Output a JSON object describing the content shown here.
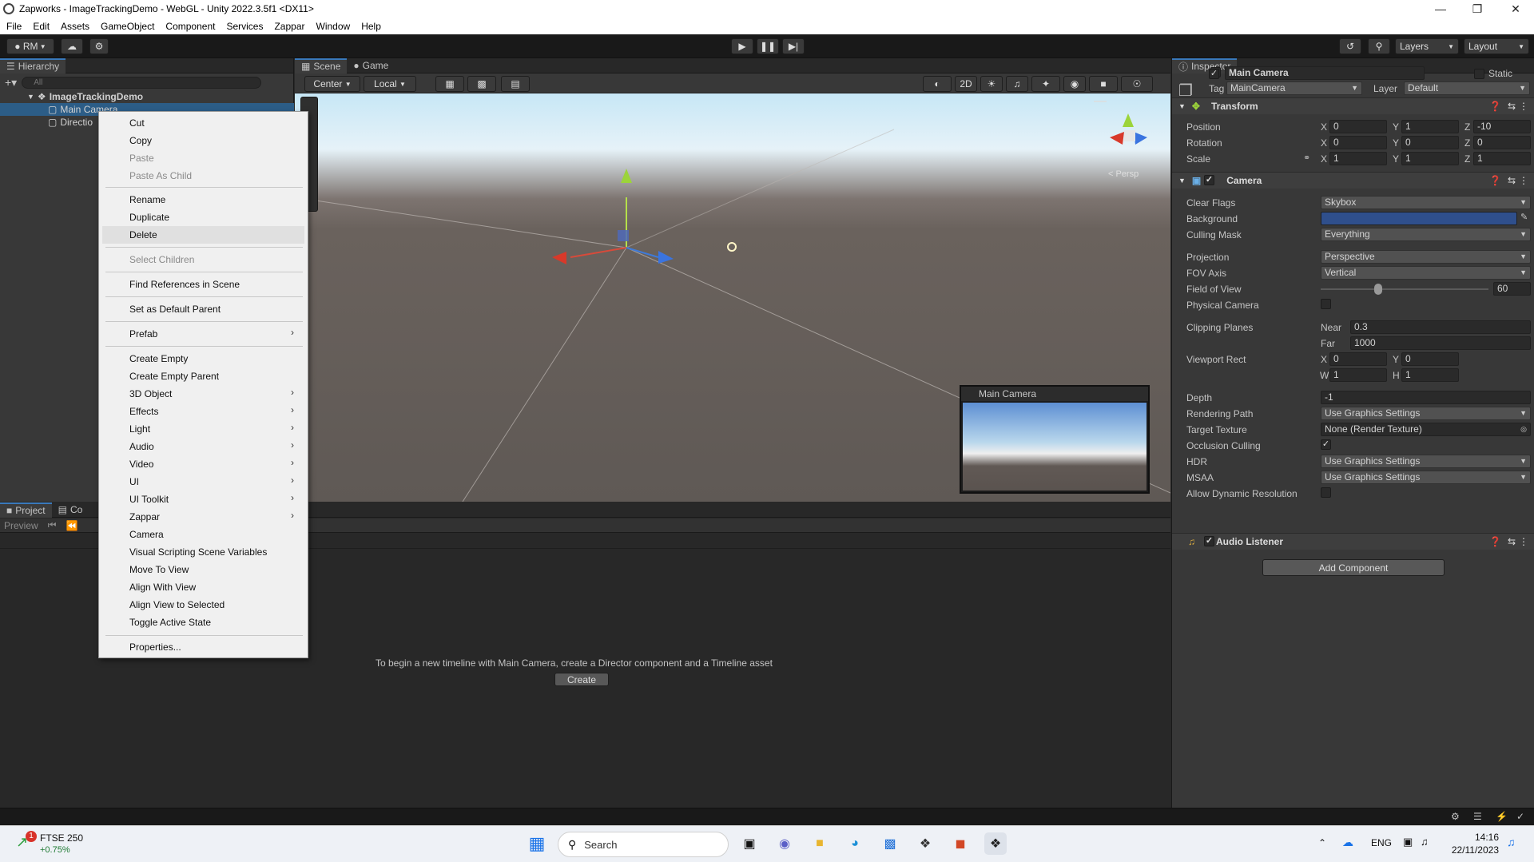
{
  "window": {
    "title": "Zapworks - ImageTrackingDemo - WebGL - Unity 2022.3.5f1 <DX11>"
  },
  "menu": [
    "File",
    "Edit",
    "Assets",
    "GameObject",
    "Component",
    "Services",
    "Zappar",
    "Window",
    "Help"
  ],
  "toolbar": {
    "account": "RM",
    "layers": "Layers",
    "layout": "Layout"
  },
  "hierarchy": {
    "tab": "Hierarchy",
    "search_placeholder": "All",
    "scene_name": "ImageTrackingDemo",
    "items": [
      "Main Camera",
      "Directio"
    ]
  },
  "scene": {
    "tabs": [
      "Scene",
      "Game"
    ],
    "pivot": "Center",
    "space": "Local",
    "mode_2d": "2D",
    "persp": "< Persp",
    "preview_title": "Main Camera"
  },
  "context_menu": [
    {
      "label": "Cut",
      "disabled": false
    },
    {
      "label": "Copy",
      "disabled": false
    },
    {
      "label": "Paste",
      "disabled": true
    },
    {
      "label": "Paste As Child",
      "disabled": true
    },
    {
      "label": "Rename",
      "disabled": false
    },
    {
      "label": "Duplicate",
      "disabled": false
    },
    {
      "label": "Delete",
      "disabled": false
    },
    {
      "label": "Select Children",
      "disabled": true
    },
    {
      "label": "Find References in Scene",
      "disabled": false
    },
    {
      "label": "Set as Default Parent",
      "disabled": false
    },
    {
      "label": "Prefab",
      "disabled": false,
      "submenu": true
    },
    {
      "label": "Create Empty",
      "disabled": false
    },
    {
      "label": "Create Empty Parent",
      "disabled": false
    },
    {
      "label": "3D Object",
      "disabled": false,
      "submenu": true
    },
    {
      "label": "Effects",
      "disabled": false,
      "submenu": true
    },
    {
      "label": "Light",
      "disabled": false,
      "submenu": true
    },
    {
      "label": "Audio",
      "disabled": false,
      "submenu": true
    },
    {
      "label": "Video",
      "disabled": false,
      "submenu": true
    },
    {
      "label": "UI",
      "disabled": false,
      "submenu": true
    },
    {
      "label": "UI Toolkit",
      "disabled": false,
      "submenu": true
    },
    {
      "label": "Zappar",
      "disabled": false,
      "submenu": true
    },
    {
      "label": "Camera",
      "disabled": false
    },
    {
      "label": "Visual Scripting Scene Variables",
      "disabled": false
    },
    {
      "label": "Move To View",
      "disabled": false
    },
    {
      "label": "Align With View",
      "disabled": false
    },
    {
      "label": "Align View to Selected",
      "disabled": false
    },
    {
      "label": "Toggle Active State",
      "disabled": false
    },
    {
      "label": "Properties...",
      "disabled": false
    }
  ],
  "project": {
    "tabs": [
      "Project",
      "Co"
    ],
    "preview": "Preview",
    "timeline_msg": "To begin a new timeline with Main Camera, create a Director component and a Timeline asset",
    "create_button": "Create"
  },
  "inspector": {
    "tab": "Inspector",
    "object_name": "Main Camera",
    "static_label": "Static",
    "tag_label": "Tag",
    "tag_value": "MainCamera",
    "layer_label": "Layer",
    "layer_value": "Default",
    "transform": {
      "title": "Transform",
      "position_label": "Position",
      "position": [
        "0",
        "1",
        "-10"
      ],
      "rotation_label": "Rotation",
      "rotation": [
        "0",
        "0",
        "0"
      ],
      "scale_label": "Scale",
      "scale": [
        "1",
        "1",
        "1"
      ]
    },
    "camera": {
      "title": "Camera",
      "clear_flags_label": "Clear Flags",
      "clear_flags": "Skybox",
      "background_label": "Background",
      "background_color": "#2f4f8c",
      "culling_mask_label": "Culling Mask",
      "culling_mask": "Everything",
      "projection_label": "Projection",
      "projection": "Perspective",
      "fov_axis_label": "FOV Axis",
      "fov_axis": "Vertical",
      "fov_label": "Field of View",
      "fov": "60",
      "physical_label": "Physical Camera",
      "clipping_label": "Clipping Planes",
      "near_label": "Near",
      "near": "0.3",
      "far_label": "Far",
      "far": "1000",
      "viewport_label": "Viewport Rect",
      "vx": "0",
      "vy": "0",
      "vw": "1",
      "vh": "1",
      "depth_label": "Depth",
      "depth": "-1",
      "rendering_path_label": "Rendering Path",
      "rendering_path": "Use Graphics Settings",
      "target_texture_label": "Target Texture",
      "target_texture": "None (Render Texture)",
      "occlusion_label": "Occlusion Culling",
      "hdr_label": "HDR",
      "hdr": "Use Graphics Settings",
      "msaa_label": "MSAA",
      "msaa": "Use Graphics Settings",
      "dynres_label": "Allow Dynamic Resolution"
    },
    "audio_listener": "Audio Listener",
    "add_component": "Add Component"
  },
  "taskbar": {
    "ticker": "FTSE 250",
    "ticker_change": "+0.75%",
    "notification": "1",
    "search": "Search",
    "lang": "ENG",
    "time": "14:16",
    "date": "22/11/2023"
  }
}
